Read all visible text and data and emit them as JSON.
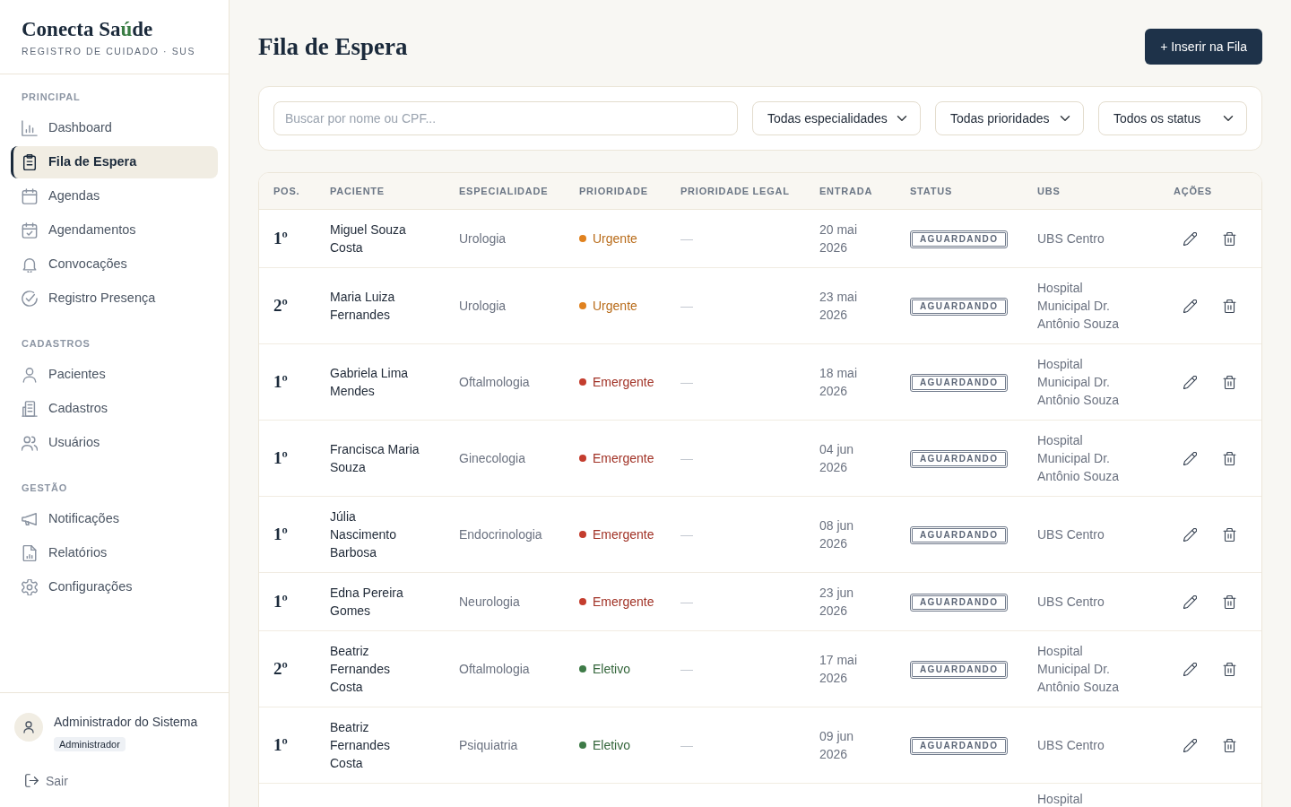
{
  "sidebar": {
    "brand": {
      "name_parts": [
        {
          "text": "Conecta Sa",
          "accent": false
        },
        {
          "text": "ú",
          "accent": true
        },
        {
          "text": "de",
          "accent": false
        }
      ],
      "subtitle": "REGISTRO DE CUIDADO · SUS"
    },
    "sections": [
      {
        "heading": "PRINCIPAL",
        "items": [
          {
            "label": "Dashboard",
            "selected": false
          },
          {
            "label": "Fila de Espera",
            "selected": true
          },
          {
            "label": "Agendas",
            "selected": false
          },
          {
            "label": "Agendamentos",
            "selected": false
          },
          {
            "label": "Convocações",
            "selected": false
          },
          {
            "label": "Registro Presença",
            "selected": false
          }
        ]
      },
      {
        "heading": "CADASTROS",
        "items": [
          {
            "label": "Pacientes",
            "selected": false
          },
          {
            "label": "Cadastros",
            "selected": false
          },
          {
            "label": "Usuários",
            "selected": false
          }
        ]
      },
      {
        "heading": "GESTÃO",
        "items": [
          {
            "label": "Notificações",
            "selected": false
          },
          {
            "label": "Relatórios",
            "selected": false
          },
          {
            "label": "Configurações",
            "selected": false
          }
        ]
      }
    ],
    "user": {
      "name": "Administrador do Sistema",
      "role": "Administrador"
    },
    "logout": "Sair"
  },
  "page": {
    "title": "Fila de Espera",
    "primary_button": "+ Inserir na Fila"
  },
  "filters": {
    "search": {
      "placeholder": "Buscar por nome ou CPF..."
    },
    "selects": [
      {
        "value": "Todas especialidades"
      },
      {
        "value": "Todas prioridades"
      },
      {
        "value": "Todos os status"
      }
    ]
  },
  "table": {
    "columns": [
      "POS.",
      "PACIENTE",
      "ESPECIALIDADE",
      "PRIORIDADE",
      "PRIORIDADE LEGAL",
      "ENTRADA",
      "STATUS",
      "UBS",
      "AÇÕES"
    ],
    "rows": [
      {
        "position": "1º",
        "patient": "Miguel Souza Costa",
        "specialty": "Urologia",
        "priority": {
          "label": "Urgente",
          "color": "#e0821f"
        },
        "legal_priority": "—",
        "entry": "20 mai 2026",
        "status": "AGUARDANDO",
        "ubs": "UBS Centro"
      },
      {
        "position": "2º",
        "patient": "Maria Luiza Fernandes",
        "specialty": "Urologia",
        "priority": {
          "label": "Urgente",
          "color": "#e0821f"
        },
        "legal_priority": "—",
        "entry": "23 mai 2026",
        "status": "AGUARDANDO",
        "ubs": "Hospital Municipal Dr. Antônio Souza"
      },
      {
        "position": "1º",
        "patient": "Gabriela Lima Mendes",
        "specialty": "Oftalmologia",
        "priority": {
          "label": "Emergente",
          "color": "#c43d2e"
        },
        "legal_priority": "—",
        "entry": "18 mai 2026",
        "status": "AGUARDANDO",
        "ubs": "Hospital Municipal Dr. Antônio Souza"
      },
      {
        "position": "1º",
        "patient": "Francisca Maria Souza",
        "specialty": "Ginecologia",
        "priority": {
          "label": "Emergente",
          "color": "#c43d2e"
        },
        "legal_priority": "—",
        "entry": "04 jun 2026",
        "status": "AGUARDANDO",
        "ubs": "Hospital Municipal Dr. Antônio Souza"
      },
      {
        "position": "1º",
        "patient": "Júlia Nascimento Barbosa",
        "specialty": "Endocrinologia",
        "priority": {
          "label": "Emergente",
          "color": "#c43d2e"
        },
        "legal_priority": "—",
        "entry": "08 jun 2026",
        "status": "AGUARDANDO",
        "ubs": "UBS Centro"
      },
      {
        "position": "1º",
        "patient": "Edna Pereira Gomes",
        "specialty": "Neurologia",
        "priority": {
          "label": "Emergente",
          "color": "#c43d2e"
        },
        "legal_priority": "—",
        "entry": "23 jun 2026",
        "status": "AGUARDANDO",
        "ubs": "UBS Centro"
      },
      {
        "position": "2º",
        "patient": "Beatriz Fernandes Costa",
        "specialty": "Oftalmologia",
        "priority": {
          "label": "Eletivo",
          "color": "#3e7b47"
        },
        "legal_priority": "—",
        "entry": "17 mai 2026",
        "status": "AGUARDANDO",
        "ubs": "Hospital Municipal Dr. Antônio Souza"
      },
      {
        "position": "1º",
        "patient": "Beatriz Fernandes Costa",
        "specialty": "Psiquiatria",
        "priority": {
          "label": "Eletivo",
          "color": "#3e7b47"
        },
        "legal_priority": "—",
        "entry": "09 jun 2026",
        "status": "AGUARDANDO",
        "ubs": "UBS Centro"
      },
      {
        "ubs": "Hospital"
      }
    ]
  }
}
